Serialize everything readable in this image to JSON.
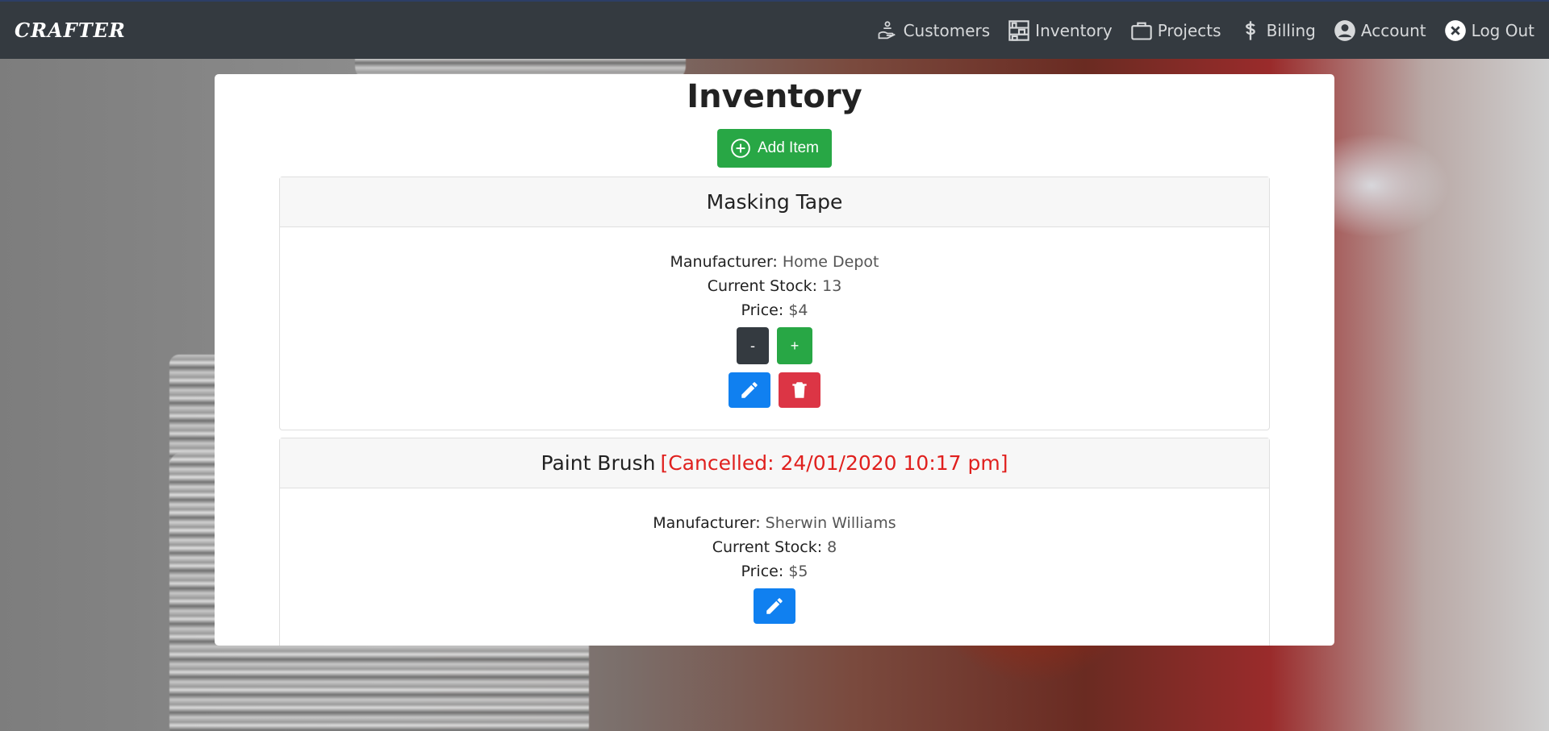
{
  "navbar": {
    "brand": "CRAFTER",
    "links": [
      {
        "label": "Customers",
        "icon": "hand-icon"
      },
      {
        "label": "Inventory",
        "icon": "shelves-icon"
      },
      {
        "label": "Projects",
        "icon": "briefcase-icon"
      },
      {
        "label": "Billing",
        "icon": "dollar-icon"
      },
      {
        "label": "Account",
        "icon": "user-circle-icon"
      },
      {
        "label": "Log Out",
        "icon": "close-circle-icon"
      }
    ]
  },
  "page": {
    "title": "Inventory",
    "add_label": "Add Item"
  },
  "items": [
    {
      "name": "Masking Tape",
      "status": "",
      "manufacturer_label": "Manufacturer:",
      "manufacturer": "Home Depot",
      "stock_label": "Current Stock:",
      "stock": "13",
      "price_label": "Price:",
      "price": "$4",
      "minus_label": "-",
      "plus_label": "+"
    },
    {
      "name": "Paint Brush",
      "status": "[Cancelled: 24/01/2020 10:17 pm]",
      "manufacturer_label": "Manufacturer:",
      "manufacturer": "Sherwin Williams",
      "stock_label": "Current Stock:",
      "stock": "8",
      "price_label": "Price:",
      "price": "$5"
    }
  ],
  "colors": {
    "navbar": "#343a40",
    "success": "#28a745",
    "primary": "#1080f0",
    "danger": "#dc3545",
    "cancelled": "#e0201e"
  }
}
